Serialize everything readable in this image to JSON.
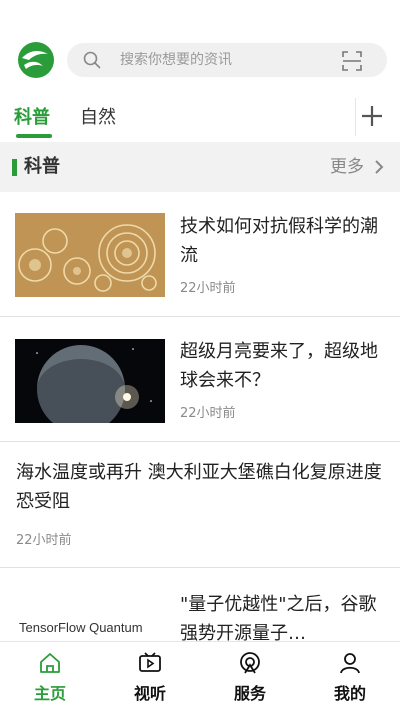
{
  "colors": {
    "accent": "#2a9d3a"
  },
  "header": {
    "logo_icon": "app-logo-icon",
    "search": {
      "placeholder": "搜索你想要的资讯",
      "icon": "search-icon",
      "scan_icon": "scan-icon"
    }
  },
  "tabs": [
    {
      "label": "科普",
      "active": true
    },
    {
      "label": "自然",
      "active": false
    }
  ],
  "tabs_add_icon": "plus-icon",
  "section": {
    "title": "科普",
    "more": "更多"
  },
  "news": [
    {
      "title": "技术如何对抗假科学的潮流",
      "time": "22小时前"
    },
    {
      "title": "超级月亮要来了，超级地球会来不？",
      "time": "22小时前"
    },
    {
      "title": "海水温度或再升 澳大利亚大堡礁白化复原进度恐受阻",
      "time": "22小时前"
    },
    {
      "title": "\"量子优越性\"之后，谷歌强势开源量子…",
      "time": "",
      "thumb_text": "TensorFlow Quantum"
    }
  ],
  "bottom_nav": [
    {
      "label": "主页",
      "icon": "home-icon",
      "active": true
    },
    {
      "label": "视听",
      "icon": "video-icon",
      "active": false
    },
    {
      "label": "服务",
      "icon": "service-icon",
      "active": false
    },
    {
      "label": "我的",
      "icon": "user-icon",
      "active": false
    }
  ]
}
